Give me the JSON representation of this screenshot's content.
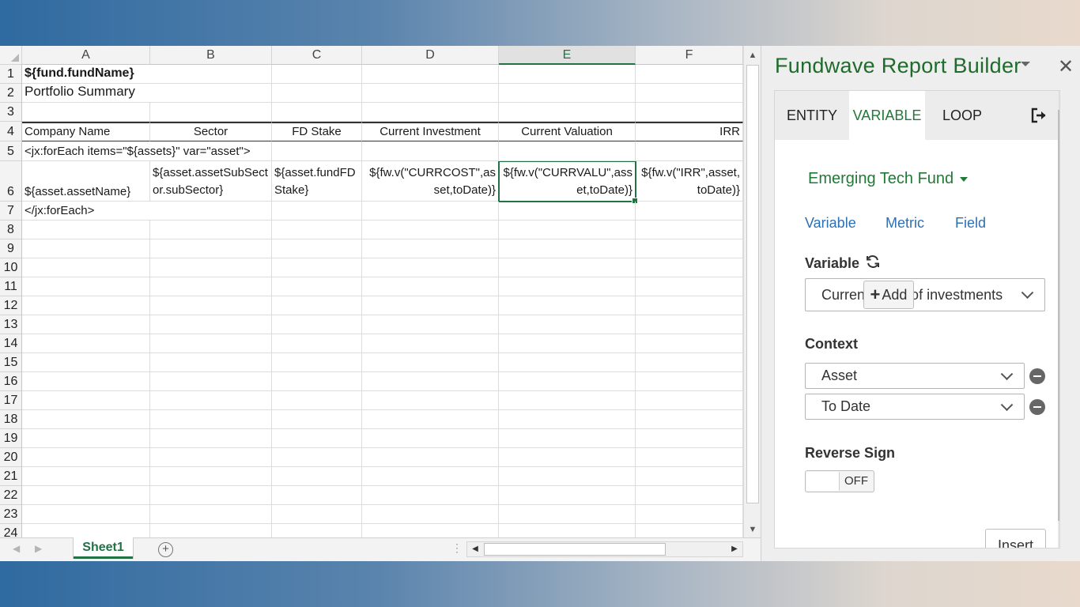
{
  "sheet": {
    "columns": [
      "A",
      "B",
      "C",
      "D",
      "E",
      "F"
    ],
    "selected_column": "E",
    "rows": [
      "1",
      "2",
      "3",
      "4",
      "5",
      "6",
      "7",
      "8",
      "9",
      "10",
      "11",
      "12",
      "13",
      "14",
      "15",
      "16",
      "17",
      "18",
      "19",
      "20",
      "21",
      "22",
      "23",
      "24"
    ],
    "cells": {
      "A1": "${fund.fundName}",
      "A2": "Portfolio Summary",
      "A4": "Company Name",
      "B4": "Sector",
      "C4": "FD Stake",
      "D4": "Current Investment",
      "E4": "Current Valuation",
      "F4": "IRR",
      "A5": "<jx:forEach items=\"${assets}\" var=\"asset\">",
      "A6": "${asset.assetName}",
      "B6": "${asset.assetSubSector.subSector}",
      "C6": "${asset.fundFDStake}",
      "D6": "${fw.v(\"CURRCOST\",asset,toDate)}",
      "E6": "${fw.v(\"CURRVALU\",asset,toDate)}",
      "F6": "${fw.v(\"IRR\",asset,toDate)}",
      "A7": "</jx:forEach>"
    },
    "tab_name": "Sheet1",
    "add_sheet_icon": "plus-circle-icon"
  },
  "pane": {
    "title": "Fundwave Report Builder",
    "close_icon": "close-icon",
    "tabs": [
      "ENTITY",
      "VARIABLE",
      "LOOP"
    ],
    "active_tab": "VARIABLE",
    "logout_icon": "sign-out-icon",
    "fund": "Emerging Tech Fund",
    "subtabs": [
      "Variable",
      "Metric",
      "Field"
    ],
    "variable_label": "Variable",
    "refresh_icon": "refresh-icon",
    "variable_value": "Current value of investments",
    "context_label": "Context",
    "add_label": "Add",
    "context_items": [
      "Asset",
      "To Date"
    ],
    "reverse_sign_label": "Reverse Sign",
    "reverse_sign_state": "OFF",
    "insert_label": "Insert",
    "accent_color": "#1f7a36",
    "link_color": "#2e6fb0"
  }
}
